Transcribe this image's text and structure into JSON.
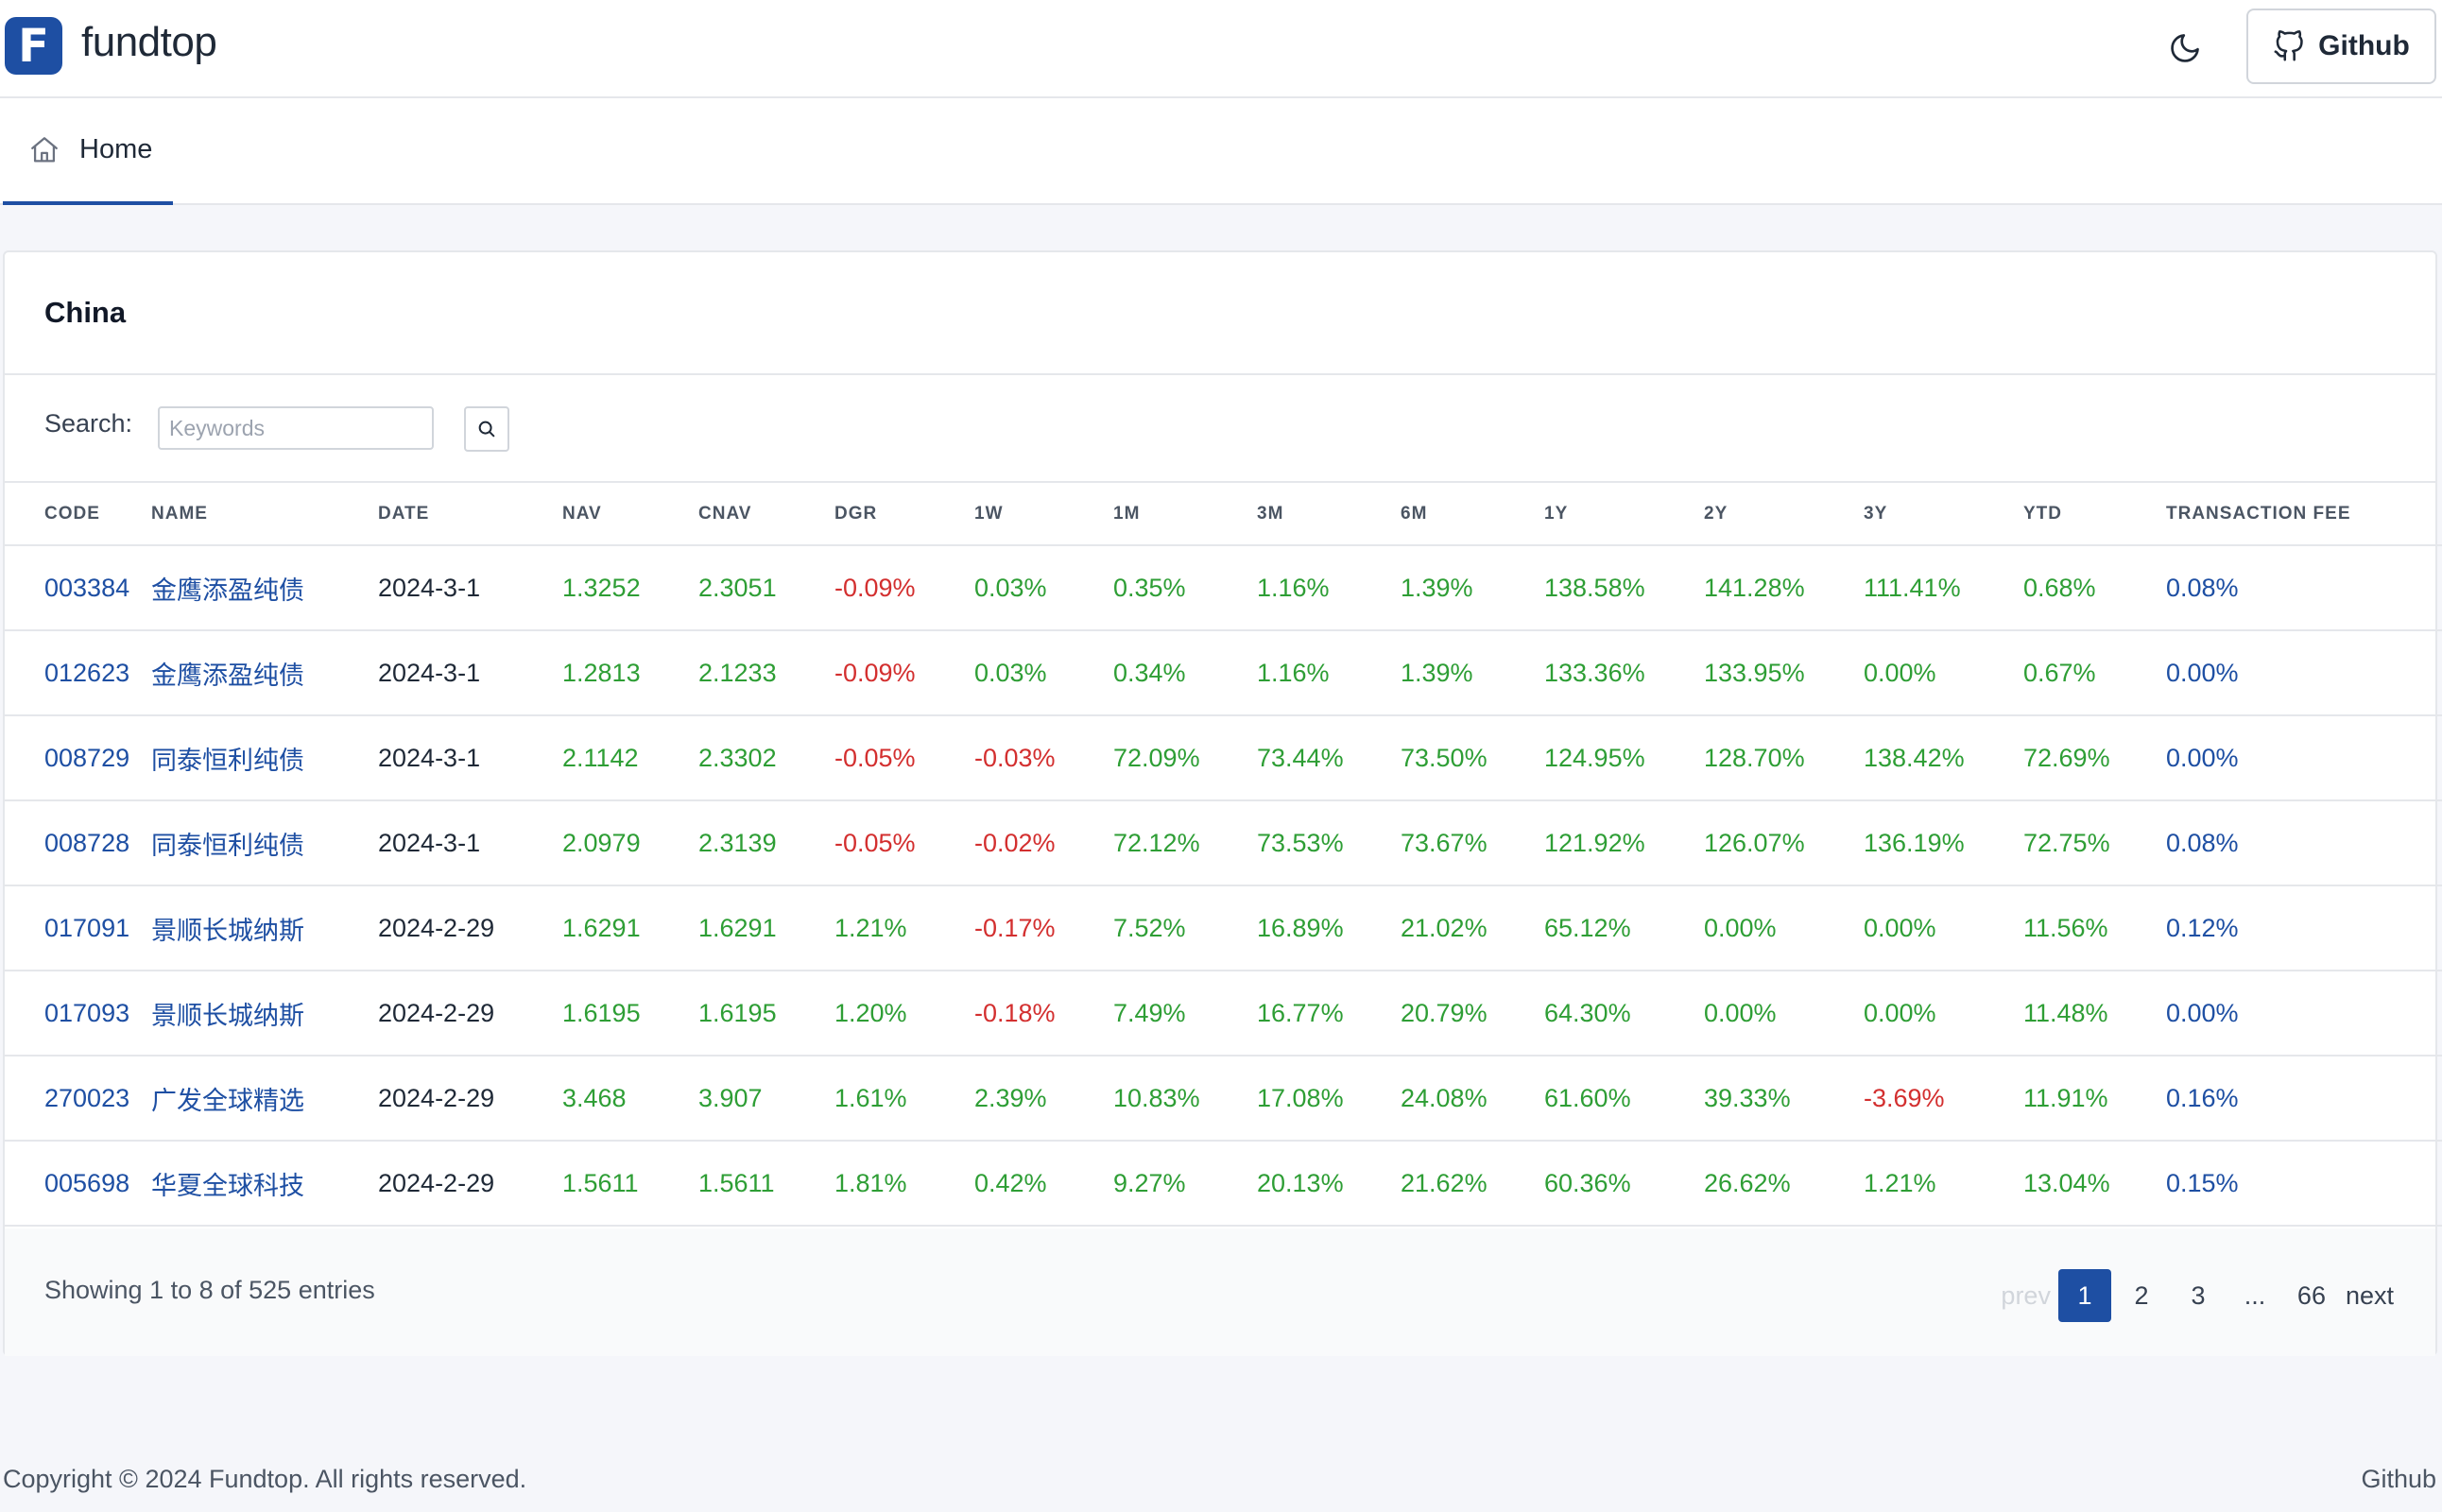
{
  "header": {
    "logo_letter": "F",
    "brand": "fundtop",
    "github_label": "Github"
  },
  "tabs": [
    {
      "label": "Home"
    }
  ],
  "card": {
    "title": "China",
    "search_label": "Search:",
    "search_placeholder": "Keywords",
    "search_value": ""
  },
  "table": {
    "columns": [
      "CODE",
      "NAME",
      "DATE",
      "NAV",
      "CNAV",
      "DGR",
      "1W",
      "1M",
      "3M",
      "6M",
      "1Y",
      "2Y",
      "3Y",
      "YTD",
      "TRANSACTION FEE"
    ],
    "rows": [
      [
        "003384",
        "金鹰添盈纯债",
        "2024-3-1",
        "1.3252",
        "2.3051",
        "-0.09%",
        "0.03%",
        "0.35%",
        "1.16%",
        "1.39%",
        "138.58%",
        "141.28%",
        "111.41%",
        "0.68%",
        "0.08%"
      ],
      [
        "012623",
        "金鹰添盈纯债",
        "2024-3-1",
        "1.2813",
        "2.1233",
        "-0.09%",
        "0.03%",
        "0.34%",
        "1.16%",
        "1.39%",
        "133.36%",
        "133.95%",
        "0.00%",
        "0.67%",
        "0.00%"
      ],
      [
        "008729",
        "同泰恒利纯债",
        "2024-3-1",
        "2.1142",
        "2.3302",
        "-0.05%",
        "-0.03%",
        "72.09%",
        "73.44%",
        "73.50%",
        "124.95%",
        "128.70%",
        "138.42%",
        "72.69%",
        "0.00%"
      ],
      [
        "008728",
        "同泰恒利纯债",
        "2024-3-1",
        "2.0979",
        "2.3139",
        "-0.05%",
        "-0.02%",
        "72.12%",
        "73.53%",
        "73.67%",
        "121.92%",
        "126.07%",
        "136.19%",
        "72.75%",
        "0.08%"
      ],
      [
        "017091",
        "景顺长城纳斯",
        "2024-2-29",
        "1.6291",
        "1.6291",
        "1.21%",
        "-0.17%",
        "7.52%",
        "16.89%",
        "21.02%",
        "65.12%",
        "0.00%",
        "0.00%",
        "11.56%",
        "0.12%"
      ],
      [
        "017093",
        "景顺长城纳斯",
        "2024-2-29",
        "1.6195",
        "1.6195",
        "1.20%",
        "-0.18%",
        "7.49%",
        "16.77%",
        "20.79%",
        "64.30%",
        "0.00%",
        "0.00%",
        "11.48%",
        "0.00%"
      ],
      [
        "270023",
        "广发全球精选",
        "2024-2-29",
        "3.468",
        "3.907",
        "1.61%",
        "2.39%",
        "10.83%",
        "17.08%",
        "24.08%",
        "61.60%",
        "39.33%",
        "-3.69%",
        "11.91%",
        "0.16%"
      ],
      [
        "005698",
        "华夏全球科技",
        "2024-2-29",
        "1.5611",
        "1.5611",
        "1.81%",
        "0.42%",
        "9.27%",
        "20.13%",
        "21.62%",
        "60.36%",
        "26.62%",
        "1.21%",
        "13.04%",
        "0.15%"
      ]
    ]
  },
  "pagination": {
    "info": "Showing 1 to 8 of 525 entries",
    "prev_label": "prev",
    "next_label": "next",
    "pages": [
      "1",
      "2",
      "3",
      "...",
      "66"
    ],
    "active_page": "1"
  },
  "footer": {
    "copyright": "Copyright © 2024 Fundtop. All rights reserved.",
    "link": "Github"
  },
  "colors": {
    "brand": "#1e4fa3",
    "positive": "#2e9e35",
    "negative": "#d32f2f"
  }
}
